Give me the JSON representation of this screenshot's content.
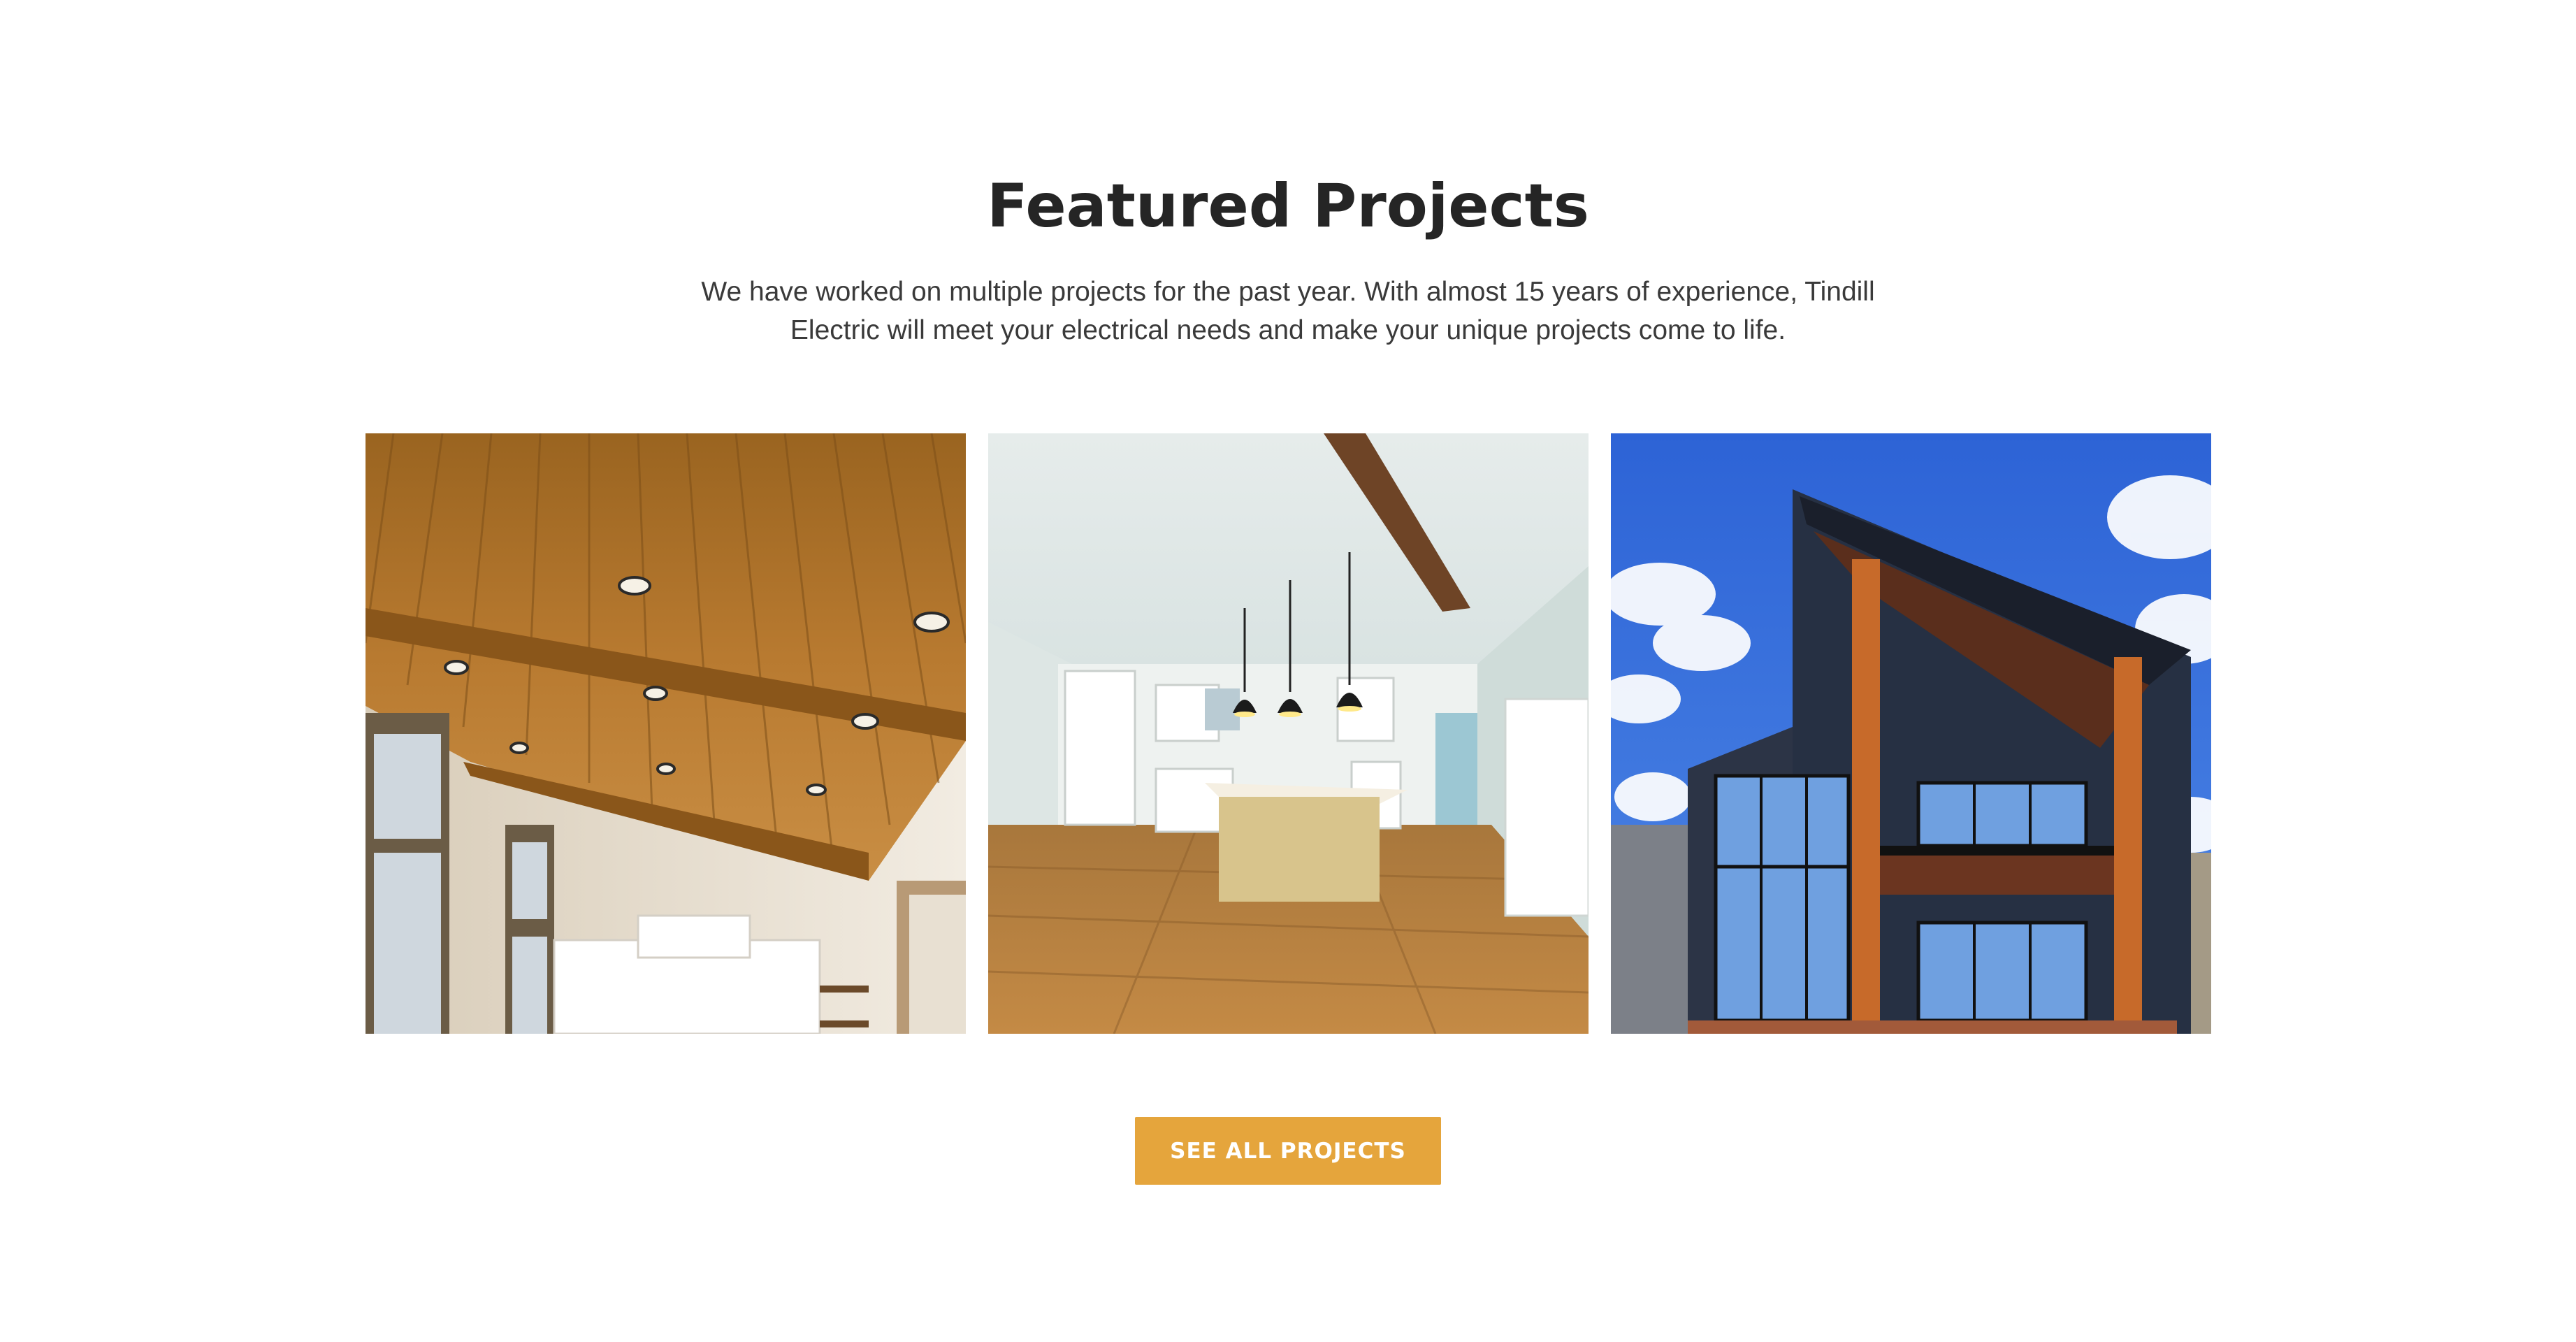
{
  "section": {
    "title": "Featured Projects",
    "description": "We have worked on multiple projects for the past year. With almost 15 years of experience, Tindill Electric will meet your electrical needs and make your unique projects come to life."
  },
  "projects": [
    {
      "image": "wood-ceiling-interior-photo"
    },
    {
      "image": "kitchen-pendant-lights-photo"
    },
    {
      "image": "modern-house-exterior-photo"
    }
  ],
  "cta": {
    "label": "SEE ALL PROJECTS"
  },
  "colors": {
    "accent": "#e5a53c",
    "heading": "#252525",
    "body_text": "#3a3a3a",
    "background": "#ffffff"
  }
}
